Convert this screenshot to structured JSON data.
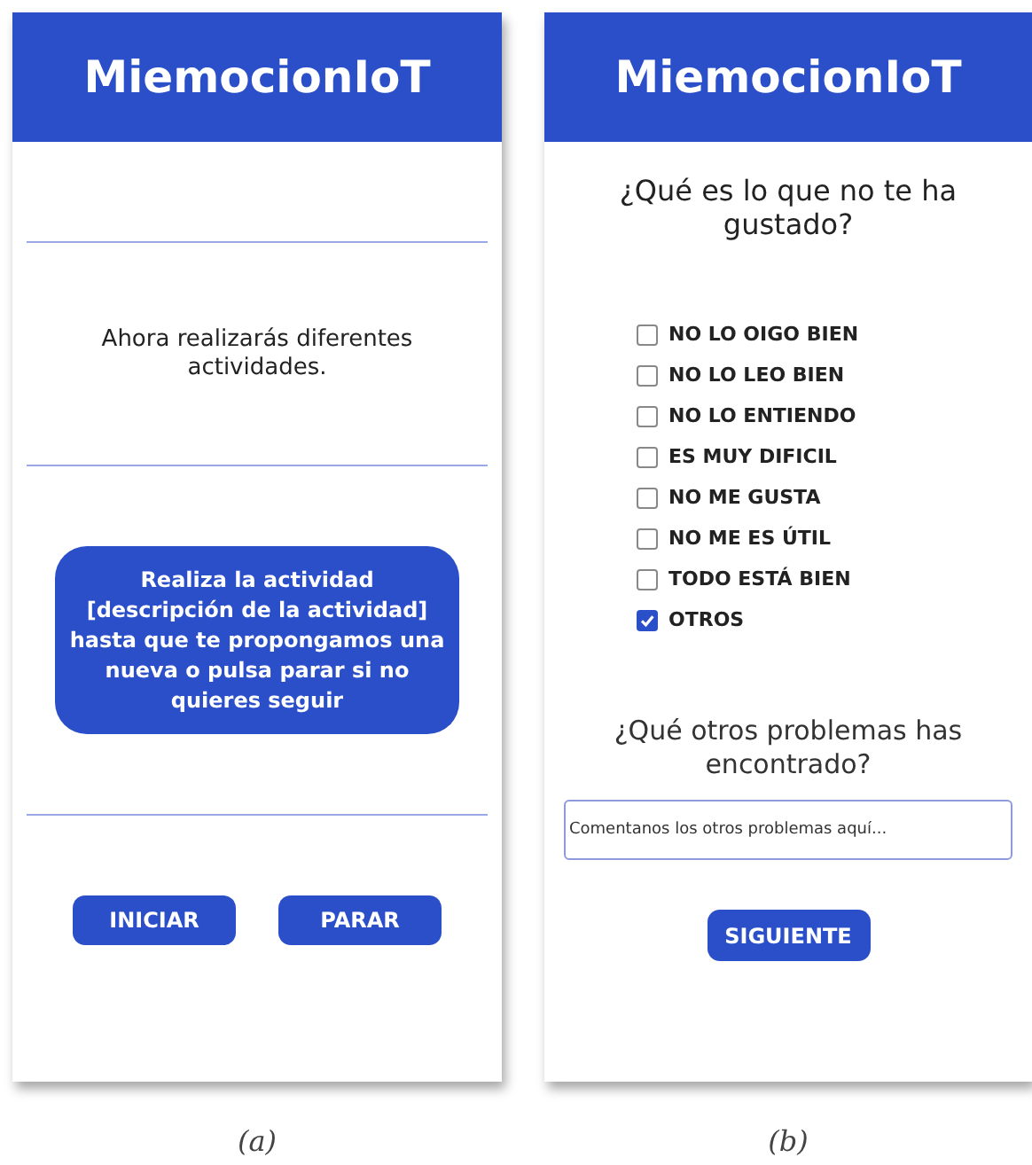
{
  "screen_a": {
    "app_title": "MiemocionIoT",
    "intro": "Ahora realizarás diferentes actividades.",
    "instruction": "Realiza la actividad [descripción de la actividad] hasta que te propongamos una nueva o pulsa parar si no quieres seguir",
    "buttons": [
      "INICIAR",
      "PARAR"
    ],
    "caption": "(a)"
  },
  "screen_b": {
    "app_title": "MiemocionIoT",
    "question": "¿Qué es lo que no te ha gustado?",
    "options": [
      {
        "label": "NO LO OIGO BIEN",
        "checked": false
      },
      {
        "label": "NO LO LEO BIEN",
        "checked": false
      },
      {
        "label": "NO LO ENTIENDO",
        "checked": false
      },
      {
        "label": "ES MUY DIFICIL",
        "checked": false
      },
      {
        "label": "NO ME GUSTA",
        "checked": false
      },
      {
        "label": "NO ME ES ÚTIL",
        "checked": false
      },
      {
        "label": "TODO ESTÁ BIEN",
        "checked": false
      },
      {
        "label": "OTROS",
        "checked": true
      }
    ],
    "other_question": "¿Qué otros problemas has encontrado?",
    "comment": {
      "placeholder": "Comentanos los otros problemas aquí..."
    },
    "button": "SIGUIENTE",
    "caption": "(b)"
  }
}
